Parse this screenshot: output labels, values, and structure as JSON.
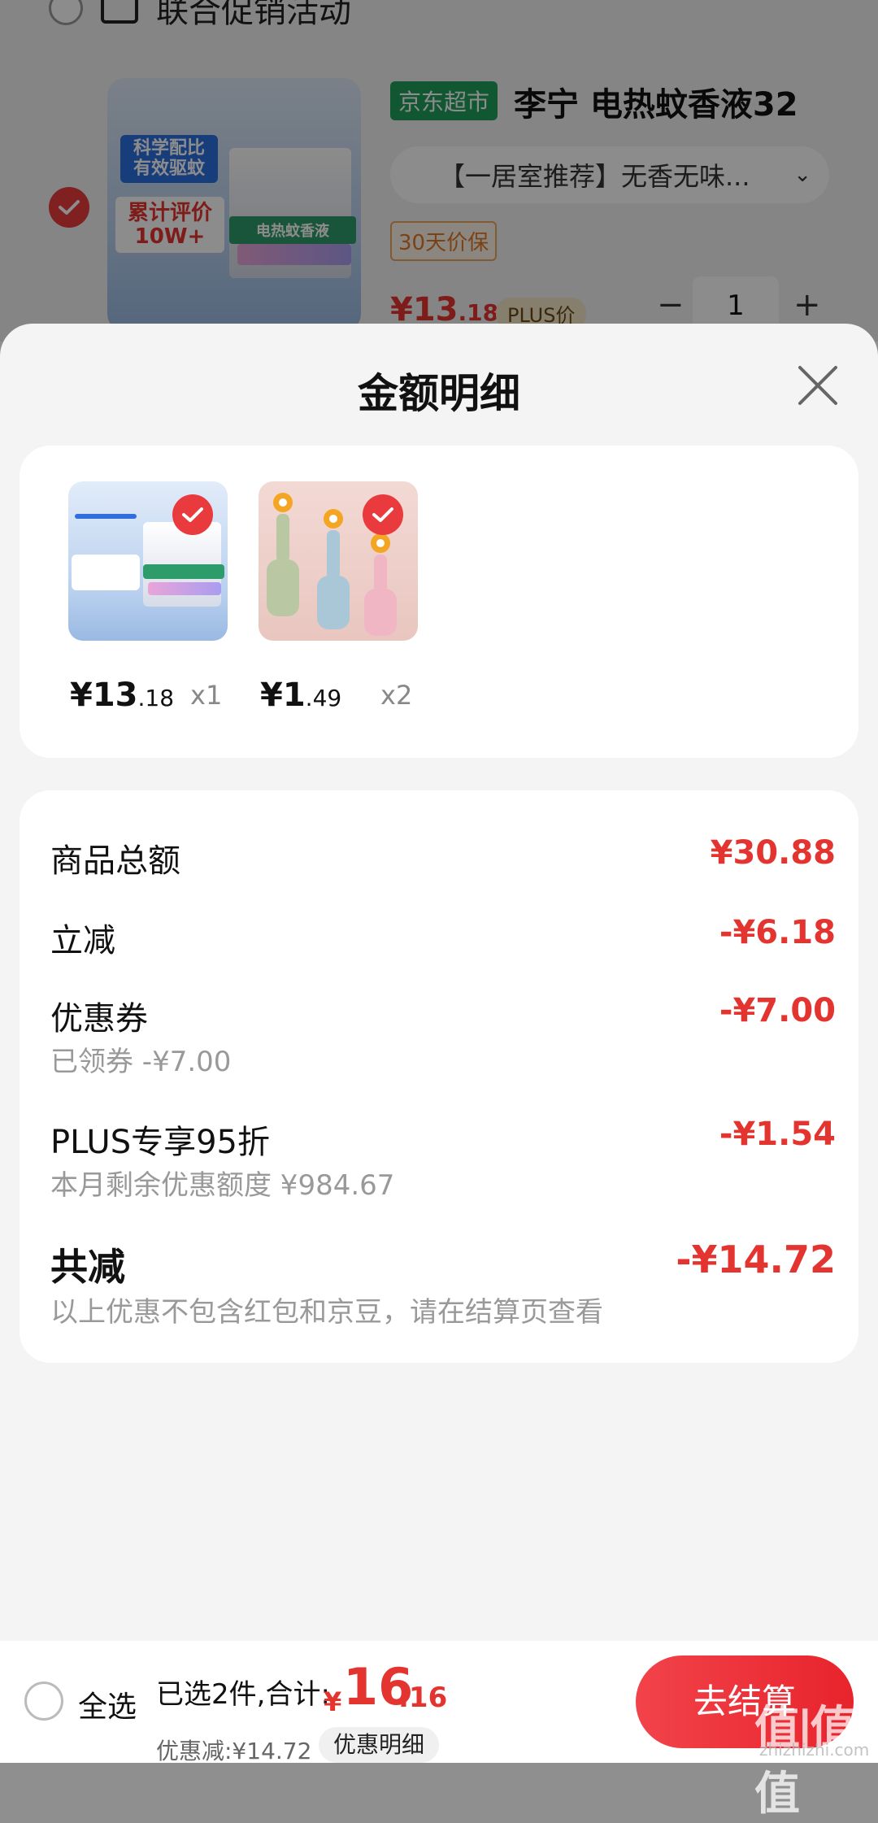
{
  "background_cart": {
    "promo_text": "联合促销活动",
    "product": {
      "channel_tag": "京东超市",
      "title": "李宁 电热蚊香液32",
      "spec": "【一居室推荐】无香无味...",
      "badge": "30天价保",
      "price_int": "¥13",
      "price_dec": ".18",
      "plus_tag": "PLUS价",
      "quantity": "1",
      "image_text_1": "科学配比\n有效驱蚊",
      "image_text_2": "累计评价\n10W+",
      "image_band": "电热蚊香液"
    }
  },
  "sheet": {
    "title": "金额明细",
    "items": [
      {
        "price_int": "¥13",
        "price_dec": ".18",
        "qty": "x1",
        "image": "mosquito-liquid"
      },
      {
        "price_int": "¥1",
        "price_dec": ".49",
        "qty": "x2",
        "image": "shoe-brush"
      }
    ],
    "breakdown": {
      "goods_total": {
        "label": "商品总额",
        "value": "¥30.88"
      },
      "instant_cut": {
        "label": "立减",
        "value": "-¥6.18"
      },
      "coupon": {
        "label": "优惠券",
        "sub": "已领券 -¥7.00",
        "value": "-¥7.00"
      },
      "plus": {
        "label": "PLUS专享95折",
        "sub": "本月剩余优惠额度 ¥984.67",
        "value": "-¥1.54"
      },
      "total_cut": {
        "label": "共减",
        "sub": "以上优惠不包含红包和京豆，请在结算页查看",
        "value": "-¥14.72"
      }
    }
  },
  "bottom_bar": {
    "select_all": "全选",
    "summary": "已选2件,合计:",
    "total_yen": "¥",
    "total_int": "16",
    "total_dec": ".16",
    "discount": "优惠减:¥14.72",
    "detail_button": "优惠明细",
    "checkout_button": "去结算"
  },
  "watermark": {
    "text": "值|值|值",
    "sub": "zhizhizhi.com"
  },
  "colors": {
    "accent_red": "#e3342f",
    "check_red": "#e93b3d",
    "jd_green": "#1e9e5b"
  }
}
